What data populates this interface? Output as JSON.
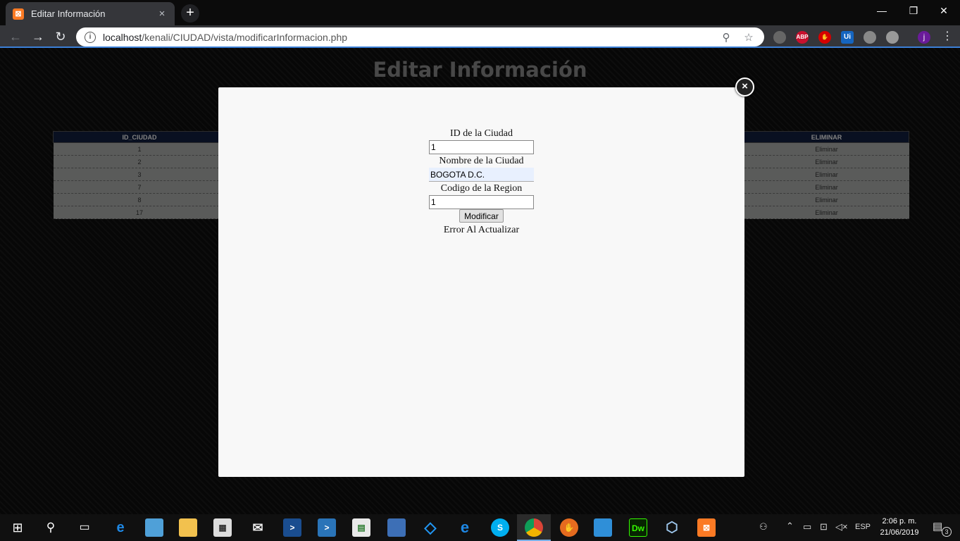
{
  "browser": {
    "tab_title": "Editar Información",
    "tab_close": "×",
    "new_tab": "+",
    "url_host": "localhost",
    "url_path": "/kenali/CIUDAD/vista/modificarInformacion.php",
    "window_minimize": "—",
    "window_restore": "❐",
    "window_close": "✕",
    "extensions": [
      "ABP",
      "Ui"
    ],
    "profile_initial": "j"
  },
  "page": {
    "title": "Editar Información",
    "table": {
      "columns": [
        "ID_CIUDAD",
        "ELIMINAR"
      ],
      "rows": [
        {
          "id": "1",
          "action": "Eliminar"
        },
        {
          "id": "2",
          "action": "Eliminar"
        },
        {
          "id": "3",
          "action": "Eliminar"
        },
        {
          "id": "7",
          "action": "Eliminar"
        },
        {
          "id": "8",
          "action": "Eliminar"
        },
        {
          "id": "17",
          "action": "Eliminar"
        }
      ]
    }
  },
  "modal": {
    "close_glyph": "×",
    "id_label": "ID de la Ciudad",
    "id_value": "1",
    "name_label": "Nombre de la Ciudad",
    "name_value": "BOGOTA D.C.",
    "region_label": "Codigo de la Region",
    "region_value": "1",
    "submit_label": "Modificar",
    "error_message": "Error Al Actualizar"
  },
  "taskbar": {
    "language": "ESP",
    "time": "2:06 p. m.",
    "date": "21/06/2019",
    "notifications": "3",
    "dreamweaver_label": "Dw"
  }
}
